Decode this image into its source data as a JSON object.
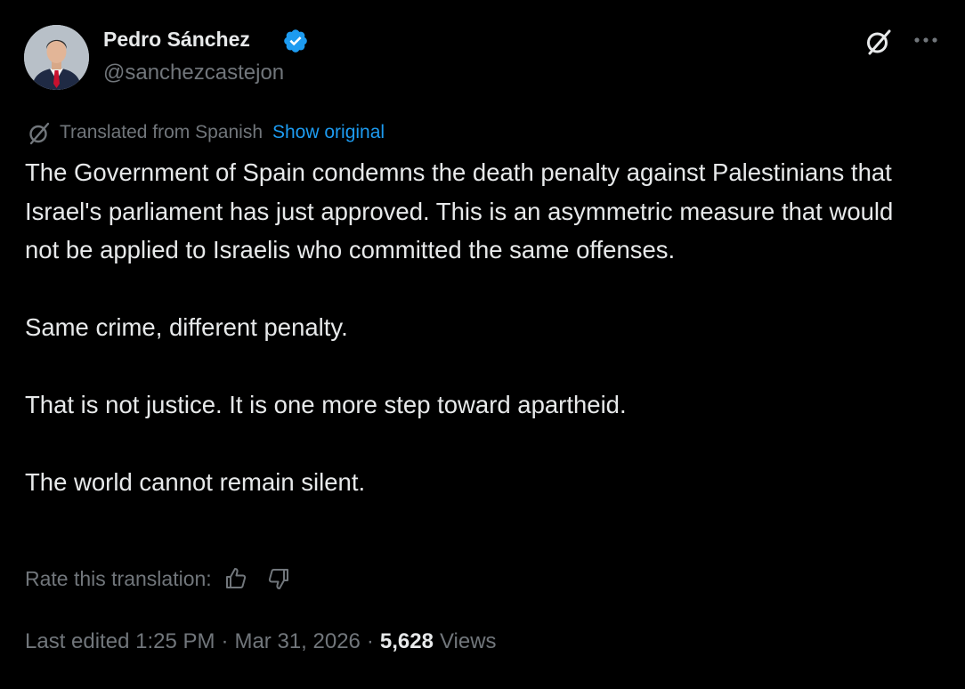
{
  "author": {
    "name": "Pedro Sánchez",
    "handle": "@sanchezcastejon",
    "verified": true,
    "verified_color": "#1d9bf0"
  },
  "header_actions": {
    "grok_icon": "grok-icon",
    "more_icon": "more-icon"
  },
  "translation": {
    "icon": "translate-icon",
    "label": "Translated from Spanish",
    "show_original": "Show original"
  },
  "tweet": {
    "paragraphs": [
      "The Government of Spain condemns the death penalty against Palestinians that Israel's parliament has just approved. This is an asymmetric measure that would not be applied to Israelis who committed the same offenses.",
      "Same crime, different penalty.",
      "That is not justice. It is one more step toward apartheid.",
      "The world cannot remain silent."
    ]
  },
  "rate": {
    "label": "Rate this translation:",
    "thumbs_up_icon": "thumbs-up-icon",
    "thumbs_down_icon": "thumbs-down-icon"
  },
  "meta": {
    "edited_label": "Last edited 1:25 PM",
    "date": "Mar 31, 2026",
    "separator": "·",
    "views_count": "5,628",
    "views_label": "Views"
  },
  "colors": {
    "background": "#000000",
    "text_primary": "#e7e9ea",
    "text_secondary": "#71767b",
    "link": "#1d9bf0"
  }
}
